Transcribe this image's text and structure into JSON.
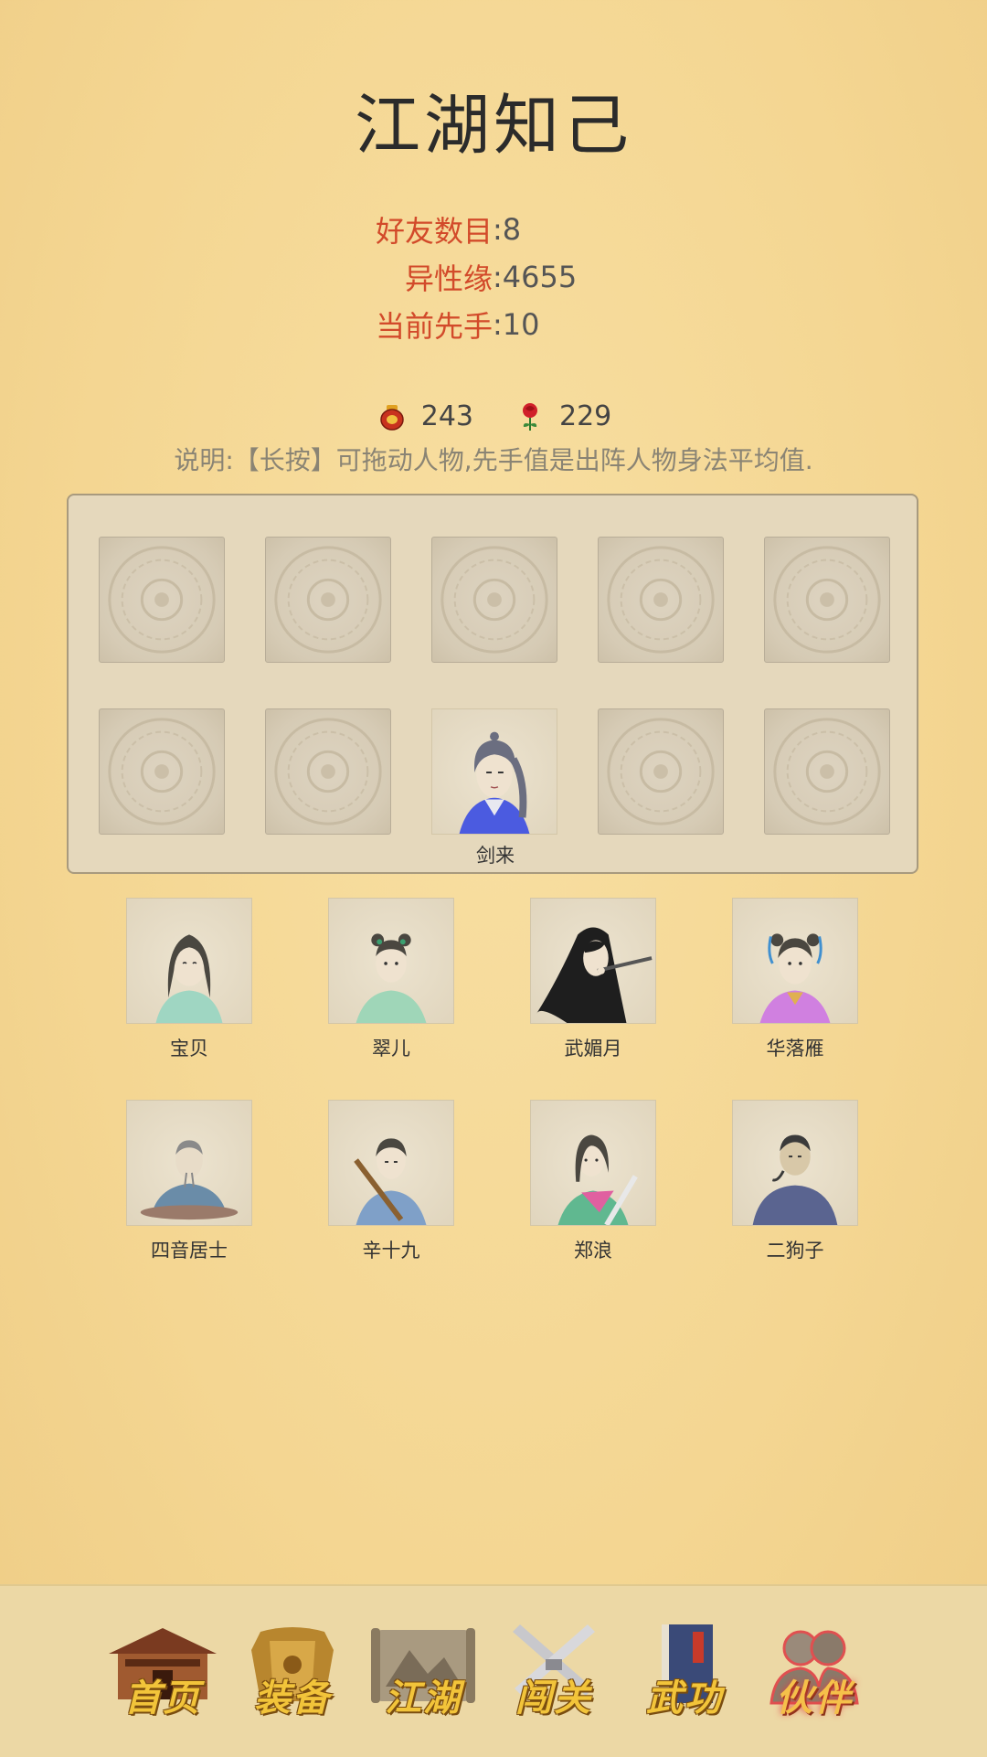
{
  "title": "江湖知己",
  "stats": [
    {
      "label": "好友数目",
      "value": ":8"
    },
    {
      "label": "异性缘",
      "value": ":4655"
    },
    {
      "label": "当前先手",
      "value": ":10"
    }
  ],
  "resources": [
    {
      "icon": "wine-jar-icon",
      "value": "243"
    },
    {
      "icon": "rose-icon",
      "value": "229"
    }
  ],
  "note": "说明:【长按】可拖动人物,先手值是出阵人物身法平均值.",
  "team": {
    "slots": [
      "",
      "",
      "",
      "",
      "",
      "",
      "",
      "剑来",
      "",
      ""
    ]
  },
  "roster": [
    {
      "name": "宝贝"
    },
    {
      "name": "翠儿"
    },
    {
      "name": "武媚月"
    },
    {
      "name": "华落雁"
    },
    {
      "name": "四音居士"
    },
    {
      "name": "辛十九"
    },
    {
      "name": "郑浪"
    },
    {
      "name": "二狗子"
    }
  ],
  "nav": [
    {
      "label": "首页",
      "icon": "house-icon"
    },
    {
      "label": "装备",
      "icon": "armor-icon"
    },
    {
      "label": "江湖",
      "icon": "scroll-map-icon"
    },
    {
      "label": "闯关",
      "icon": "crossed-swords-icon"
    },
    {
      "label": "武功",
      "icon": "book-icon"
    },
    {
      "label": "伙伴",
      "icon": "companions-icon",
      "active": true
    }
  ],
  "colors": {
    "accent_red": "#d24a2a",
    "nav_gold": "#f2c43a"
  }
}
